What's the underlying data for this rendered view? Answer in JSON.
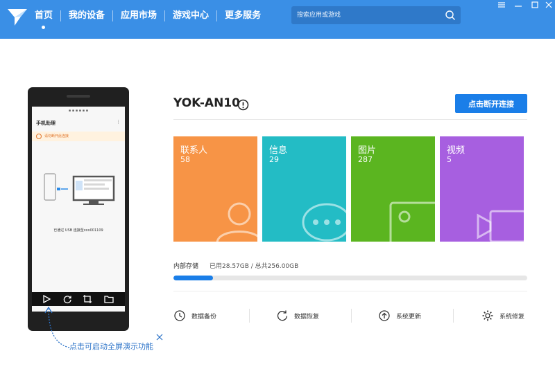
{
  "header": {
    "nav": [
      "首页",
      "我的设备",
      "应用市场",
      "游戏中心",
      "更多服务"
    ],
    "active_index": 0,
    "search_placeholder": "搜索应用或游戏",
    "bar_color": "#3a8fe6"
  },
  "phone": {
    "title": "手机助理",
    "banner": "请勿断开此连接",
    "connection_text": "已通过 USB 连接至xxx001109"
  },
  "tip": {
    "text": "点击可启动全屏演示功能"
  },
  "device": {
    "name": "YOK-AN10",
    "disconnect_label": "点击断开连接"
  },
  "tiles": [
    {
      "label": "联系人",
      "count": "58",
      "color": "#f79446",
      "icon": "contact-icon"
    },
    {
      "label": "信息",
      "count": "29",
      "color": "#23bcc5",
      "icon": "message-icon"
    },
    {
      "label": "图片",
      "count": "287",
      "color": "#5bb520",
      "icon": "picture-icon"
    },
    {
      "label": "视频",
      "count": "5",
      "color": "#a75fe0",
      "icon": "video-icon"
    }
  ],
  "storage": {
    "label": "内部存储",
    "value": "已用28.57GB / 总共256.00GB",
    "used_fraction": 0.1116
  },
  "actions": [
    {
      "label": "数据备份",
      "icon": "backup-icon"
    },
    {
      "label": "数据恢复",
      "icon": "restore-icon"
    },
    {
      "label": "系统更新",
      "icon": "update-icon"
    },
    {
      "label": "系统修复",
      "icon": "repair-icon"
    }
  ]
}
